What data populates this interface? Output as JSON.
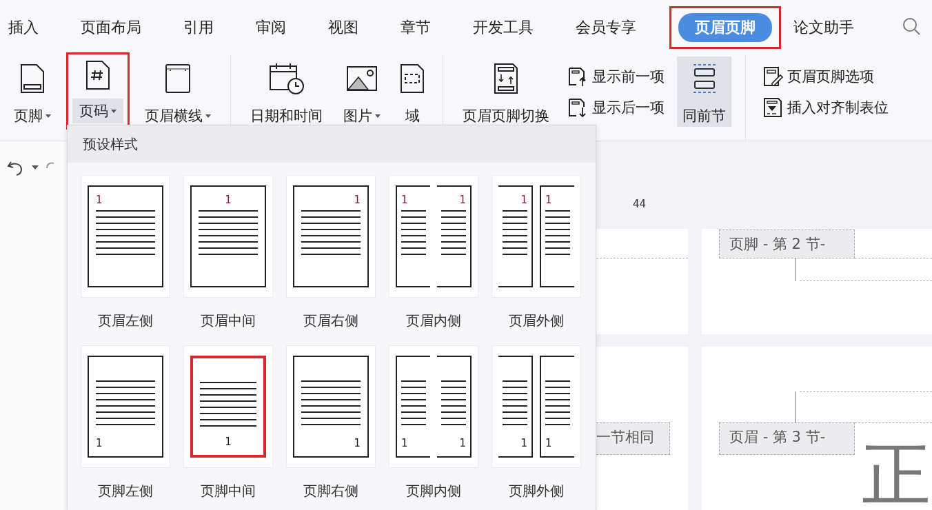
{
  "menu_tabs": [
    {
      "label": "插入",
      "selected": false,
      "highlighted": false
    },
    {
      "label": "页面布局",
      "selected": false,
      "highlighted": false
    },
    {
      "label": "引用",
      "selected": false,
      "highlighted": false
    },
    {
      "label": "审阅",
      "selected": false,
      "highlighted": false
    },
    {
      "label": "视图",
      "selected": false,
      "highlighted": false
    },
    {
      "label": "章节",
      "selected": false,
      "highlighted": false
    },
    {
      "label": "开发工具",
      "selected": false,
      "highlighted": false
    },
    {
      "label": "会员专享",
      "selected": false,
      "highlighted": false
    },
    {
      "label": "页眉页脚",
      "selected": true,
      "highlighted": true
    },
    {
      "label": "论文助手",
      "selected": false,
      "highlighted": false
    }
  ],
  "ribbon_groups": [
    {
      "items": [
        {
          "kind": "large",
          "label": "页脚",
          "dropdown": true,
          "pressed": false,
          "highlighted": false
        },
        {
          "kind": "large",
          "label": "页码",
          "dropdown": true,
          "pressed": true,
          "highlighted": true
        },
        {
          "kind": "large",
          "label": "页眉横线",
          "dropdown": true,
          "pressed": false,
          "highlighted": false
        }
      ]
    },
    {
      "items": [
        {
          "kind": "large",
          "label": "日期和时间",
          "dropdown": false,
          "pressed": false,
          "highlighted": false
        },
        {
          "kind": "large",
          "label": "图片",
          "dropdown": true,
          "pressed": false,
          "highlighted": false
        },
        {
          "kind": "large",
          "label": "域",
          "dropdown": false,
          "pressed": false,
          "highlighted": false
        }
      ]
    },
    {
      "items": [
        {
          "kind": "large",
          "label": "页眉页脚切换",
          "dropdown": false,
          "pressed": false,
          "highlighted": false
        },
        {
          "kind": "stack",
          "buttons": [
            "显示前一项",
            "显示后一项"
          ]
        },
        {
          "kind": "large",
          "label": "同前节",
          "dropdown": false,
          "pressed": true,
          "highlighted": false
        }
      ]
    },
    {
      "items": [
        {
          "kind": "stack",
          "buttons": [
            "页眉页脚选项",
            "插入对齐制表位"
          ]
        }
      ]
    }
  ],
  "gallery": {
    "title": "预设样式",
    "styles": [
      {
        "label": "页眉左侧",
        "kind": "header-left",
        "page_numbers": [
          "1"
        ],
        "selected": false
      },
      {
        "label": "页眉中间",
        "kind": "header-center",
        "page_numbers": [
          "1"
        ],
        "selected": false
      },
      {
        "label": "页眉右侧",
        "kind": "header-right",
        "page_numbers": [
          "1"
        ],
        "selected": false
      },
      {
        "label": "页眉内侧",
        "kind": "header-inside",
        "page_numbers": [
          "1",
          "1"
        ],
        "selected": false
      },
      {
        "label": "页眉外侧",
        "kind": "header-outside",
        "page_numbers": [
          "1",
          "1"
        ],
        "selected": false
      },
      {
        "label": "页脚左侧",
        "kind": "footer-left",
        "page_numbers": [
          "1"
        ],
        "selected": false
      },
      {
        "label": "页脚中间",
        "kind": "footer-center",
        "page_numbers": [
          "1"
        ],
        "selected": true
      },
      {
        "label": "页脚右侧",
        "kind": "footer-right",
        "page_numbers": [
          "1"
        ],
        "selected": false
      },
      {
        "label": "页脚内侧",
        "kind": "footer-inside",
        "page_numbers": [
          "1",
          "1"
        ],
        "selected": false
      },
      {
        "label": "页脚外侧",
        "kind": "footer-outside",
        "page_numbers": [
          "1",
          "1"
        ],
        "selected": false
      }
    ]
  },
  "document": {
    "ruler_number": "44",
    "section_labels": [
      "页脚  - 第 2 节-",
      "一节相同",
      "页眉  - 第 3 节-"
    ],
    "body_text": "正"
  }
}
